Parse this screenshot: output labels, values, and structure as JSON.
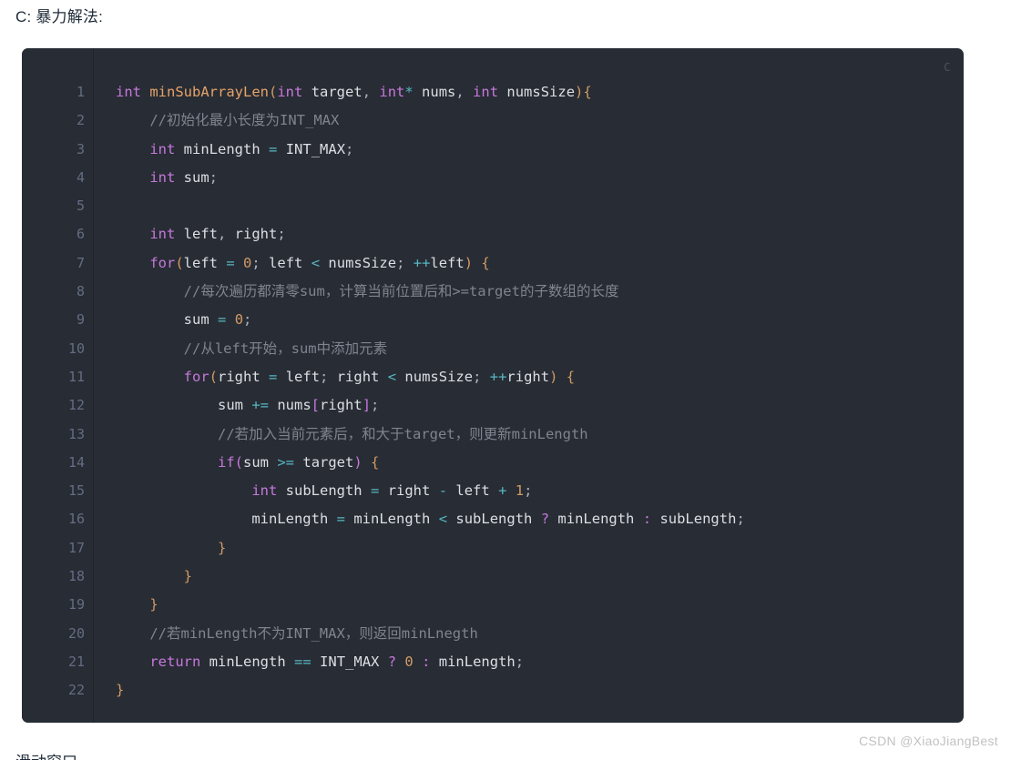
{
  "page": {
    "heading": "C: 暴力解法:",
    "footer_partial": "滑动窗口"
  },
  "code_block": {
    "language_label": "C",
    "line_numbers": [
      "1",
      "2",
      "3",
      "4",
      "5",
      "6",
      "7",
      "8",
      "9",
      "10",
      "11",
      "12",
      "13",
      "14",
      "15",
      "16",
      "17",
      "18",
      "19",
      "20",
      "21",
      "22"
    ],
    "lines": [
      {
        "n": "1",
        "text": "int minSubArrayLen(int target, int* nums, int numsSize){"
      },
      {
        "n": "2",
        "text": "    //初始化最小长度为INT_MAX"
      },
      {
        "n": "3",
        "text": "    int minLength = INT_MAX;"
      },
      {
        "n": "4",
        "text": "    int sum;"
      },
      {
        "n": "5",
        "text": ""
      },
      {
        "n": "6",
        "text": "    int left, right;"
      },
      {
        "n": "7",
        "text": "    for(left = 0; left < numsSize; ++left) {"
      },
      {
        "n": "8",
        "text": "        //每次遍历都清零sum，计算当前位置后和>=target的子数组的长度"
      },
      {
        "n": "9",
        "text": "        sum = 0;"
      },
      {
        "n": "10",
        "text": "        //从left开始，sum中添加元素"
      },
      {
        "n": "11",
        "text": "        for(right = left; right < numsSize; ++right) {"
      },
      {
        "n": "12",
        "text": "            sum += nums[right];"
      },
      {
        "n": "13",
        "text": "            //若加入当前元素后，和大于target，则更新minLength"
      },
      {
        "n": "14",
        "text": "            if(sum >= target) {"
      },
      {
        "n": "15",
        "text": "                int subLength = right - left + 1;"
      },
      {
        "n": "16",
        "text": "                minLength = minLength < subLength ? minLength : subLength;"
      },
      {
        "n": "17",
        "text": "            }"
      },
      {
        "n": "18",
        "text": "        }"
      },
      {
        "n": "19",
        "text": "    }"
      },
      {
        "n": "20",
        "text": "    //若minLength不为INT_MAX，则返回minLnegth"
      },
      {
        "n": "21",
        "text": "    return minLength == INT_MAX ? 0 : minLength;"
      },
      {
        "n": "22",
        "text": "}"
      }
    ],
    "tokens": [
      [
        {
          "c": "t-kw",
          "s": "int"
        },
        {
          "c": "t-pl",
          "s": " "
        },
        {
          "c": "t-fn",
          "s": "minSubArrayLen"
        },
        {
          "c": "t-br",
          "s": "("
        },
        {
          "c": "t-kw",
          "s": "int"
        },
        {
          "c": "t-pl",
          "s": " "
        },
        {
          "c": "t-var",
          "s": "target"
        },
        {
          "c": "t-pl",
          "s": ", "
        },
        {
          "c": "t-kw",
          "s": "int"
        },
        {
          "c": "t-op",
          "s": "*"
        },
        {
          "c": "t-pl",
          "s": " "
        },
        {
          "c": "t-var",
          "s": "nums"
        },
        {
          "c": "t-pl",
          "s": ", "
        },
        {
          "c": "t-kw",
          "s": "int"
        },
        {
          "c": "t-pl",
          "s": " "
        },
        {
          "c": "t-var",
          "s": "numsSize"
        },
        {
          "c": "t-br",
          "s": ")"
        },
        {
          "c": "t-br",
          "s": "{"
        }
      ],
      [
        {
          "c": "t-pl",
          "s": "    "
        },
        {
          "c": "t-cmt",
          "s": "//初始化最小长度为INT_MAX"
        }
      ],
      [
        {
          "c": "t-pl",
          "s": "    "
        },
        {
          "c": "t-kw",
          "s": "int"
        },
        {
          "c": "t-pl",
          "s": " "
        },
        {
          "c": "t-var",
          "s": "minLength"
        },
        {
          "c": "t-pl",
          "s": " "
        },
        {
          "c": "t-op",
          "s": "="
        },
        {
          "c": "t-pl",
          "s": " "
        },
        {
          "c": "t-con",
          "s": "INT_MAX"
        },
        {
          "c": "t-pl",
          "s": ";"
        }
      ],
      [
        {
          "c": "t-pl",
          "s": "    "
        },
        {
          "c": "t-kw",
          "s": "int"
        },
        {
          "c": "t-pl",
          "s": " "
        },
        {
          "c": "t-var",
          "s": "sum"
        },
        {
          "c": "t-pl",
          "s": ";"
        }
      ],
      [],
      [
        {
          "c": "t-pl",
          "s": "    "
        },
        {
          "c": "t-kw",
          "s": "int"
        },
        {
          "c": "t-pl",
          "s": " "
        },
        {
          "c": "t-var",
          "s": "left"
        },
        {
          "c": "t-pl",
          "s": ", "
        },
        {
          "c": "t-var",
          "s": "right"
        },
        {
          "c": "t-pl",
          "s": ";"
        }
      ],
      [
        {
          "c": "t-pl",
          "s": "    "
        },
        {
          "c": "t-kw",
          "s": "for"
        },
        {
          "c": "t-br",
          "s": "("
        },
        {
          "c": "t-var",
          "s": "left"
        },
        {
          "c": "t-pl",
          "s": " "
        },
        {
          "c": "t-op",
          "s": "="
        },
        {
          "c": "t-pl",
          "s": " "
        },
        {
          "c": "t-num",
          "s": "0"
        },
        {
          "c": "t-pl",
          "s": "; "
        },
        {
          "c": "t-var",
          "s": "left"
        },
        {
          "c": "t-pl",
          "s": " "
        },
        {
          "c": "t-op",
          "s": "<"
        },
        {
          "c": "t-pl",
          "s": " "
        },
        {
          "c": "t-var",
          "s": "numsSize"
        },
        {
          "c": "t-pl",
          "s": "; "
        },
        {
          "c": "t-op",
          "s": "++"
        },
        {
          "c": "t-var",
          "s": "left"
        },
        {
          "c": "t-br",
          "s": ")"
        },
        {
          "c": "t-pl",
          "s": " "
        },
        {
          "c": "t-br",
          "s": "{"
        }
      ],
      [
        {
          "c": "t-pl",
          "s": "        "
        },
        {
          "c": "t-cmt",
          "s": "//每次遍历都清零sum，计算当前位置后和>=target的子数组的长度"
        }
      ],
      [
        {
          "c": "t-pl",
          "s": "        "
        },
        {
          "c": "t-var",
          "s": "sum"
        },
        {
          "c": "t-pl",
          "s": " "
        },
        {
          "c": "t-op",
          "s": "="
        },
        {
          "c": "t-pl",
          "s": " "
        },
        {
          "c": "t-num",
          "s": "0"
        },
        {
          "c": "t-pl",
          "s": ";"
        }
      ],
      [
        {
          "c": "t-pl",
          "s": "        "
        },
        {
          "c": "t-cmt",
          "s": "//从left开始，sum中添加元素"
        }
      ],
      [
        {
          "c": "t-pl",
          "s": "        "
        },
        {
          "c": "t-kw",
          "s": "for"
        },
        {
          "c": "t-br",
          "s": "("
        },
        {
          "c": "t-var",
          "s": "right"
        },
        {
          "c": "t-pl",
          "s": " "
        },
        {
          "c": "t-op",
          "s": "="
        },
        {
          "c": "t-pl",
          "s": " "
        },
        {
          "c": "t-var",
          "s": "left"
        },
        {
          "c": "t-pl",
          "s": "; "
        },
        {
          "c": "t-var",
          "s": "right"
        },
        {
          "c": "t-pl",
          "s": " "
        },
        {
          "c": "t-op",
          "s": "<"
        },
        {
          "c": "t-pl",
          "s": " "
        },
        {
          "c": "t-var",
          "s": "numsSize"
        },
        {
          "c": "t-pl",
          "s": "; "
        },
        {
          "c": "t-op",
          "s": "++"
        },
        {
          "c": "t-var",
          "s": "right"
        },
        {
          "c": "t-br",
          "s": ")"
        },
        {
          "c": "t-pl",
          "s": " "
        },
        {
          "c": "t-br",
          "s": "{"
        }
      ],
      [
        {
          "c": "t-pl",
          "s": "            "
        },
        {
          "c": "t-var",
          "s": "sum"
        },
        {
          "c": "t-pl",
          "s": " "
        },
        {
          "c": "t-op",
          "s": "+="
        },
        {
          "c": "t-pl",
          "s": " "
        },
        {
          "c": "t-var",
          "s": "nums"
        },
        {
          "c": "t-pun",
          "s": "["
        },
        {
          "c": "t-var",
          "s": "right"
        },
        {
          "c": "t-pun",
          "s": "]"
        },
        {
          "c": "t-pl",
          "s": ";"
        }
      ],
      [
        {
          "c": "t-pl",
          "s": "            "
        },
        {
          "c": "t-cmt",
          "s": "//若加入当前元素后，和大于target，则更新minLength"
        }
      ],
      [
        {
          "c": "t-pl",
          "s": "            "
        },
        {
          "c": "t-kw",
          "s": "if"
        },
        {
          "c": "t-pun",
          "s": "("
        },
        {
          "c": "t-var",
          "s": "sum"
        },
        {
          "c": "t-pl",
          "s": " "
        },
        {
          "c": "t-op",
          "s": ">="
        },
        {
          "c": "t-pl",
          "s": " "
        },
        {
          "c": "t-var",
          "s": "target"
        },
        {
          "c": "t-pun",
          "s": ")"
        },
        {
          "c": "t-pl",
          "s": " "
        },
        {
          "c": "t-br",
          "s": "{"
        }
      ],
      [
        {
          "c": "t-pl",
          "s": "                "
        },
        {
          "c": "t-kw",
          "s": "int"
        },
        {
          "c": "t-pl",
          "s": " "
        },
        {
          "c": "t-var",
          "s": "subLength"
        },
        {
          "c": "t-pl",
          "s": " "
        },
        {
          "c": "t-op",
          "s": "="
        },
        {
          "c": "t-pl",
          "s": " "
        },
        {
          "c": "t-var",
          "s": "right"
        },
        {
          "c": "t-pl",
          "s": " "
        },
        {
          "c": "t-op",
          "s": "-"
        },
        {
          "c": "t-pl",
          "s": " "
        },
        {
          "c": "t-var",
          "s": "left"
        },
        {
          "c": "t-pl",
          "s": " "
        },
        {
          "c": "t-op",
          "s": "+"
        },
        {
          "c": "t-pl",
          "s": " "
        },
        {
          "c": "t-num",
          "s": "1"
        },
        {
          "c": "t-pl",
          "s": ";"
        }
      ],
      [
        {
          "c": "t-pl",
          "s": "                "
        },
        {
          "c": "t-var",
          "s": "minLength"
        },
        {
          "c": "t-pl",
          "s": " "
        },
        {
          "c": "t-op",
          "s": "="
        },
        {
          "c": "t-pl",
          "s": " "
        },
        {
          "c": "t-var",
          "s": "minLength"
        },
        {
          "c": "t-pl",
          "s": " "
        },
        {
          "c": "t-op",
          "s": "<"
        },
        {
          "c": "t-pl",
          "s": " "
        },
        {
          "c": "t-var",
          "s": "subLength"
        },
        {
          "c": "t-pl",
          "s": " "
        },
        {
          "c": "t-pun",
          "s": "?"
        },
        {
          "c": "t-pl",
          "s": " "
        },
        {
          "c": "t-var",
          "s": "minLength"
        },
        {
          "c": "t-pl",
          "s": " "
        },
        {
          "c": "t-pun",
          "s": ":"
        },
        {
          "c": "t-pl",
          "s": " "
        },
        {
          "c": "t-var",
          "s": "subLength"
        },
        {
          "c": "t-pl",
          "s": ";"
        }
      ],
      [
        {
          "c": "t-pl",
          "s": "            "
        },
        {
          "c": "t-br",
          "s": "}"
        }
      ],
      [
        {
          "c": "t-pl",
          "s": "        "
        },
        {
          "c": "t-br",
          "s": "}"
        }
      ],
      [
        {
          "c": "t-pl",
          "s": "    "
        },
        {
          "c": "t-br",
          "s": "}"
        }
      ],
      [
        {
          "c": "t-pl",
          "s": "    "
        },
        {
          "c": "t-cmt",
          "s": "//若minLength不为INT_MAX，则返回minLnegth"
        }
      ],
      [
        {
          "c": "t-pl",
          "s": "    "
        },
        {
          "c": "t-kw",
          "s": "return"
        },
        {
          "c": "t-pl",
          "s": " "
        },
        {
          "c": "t-var",
          "s": "minLength"
        },
        {
          "c": "t-pl",
          "s": " "
        },
        {
          "c": "t-op",
          "s": "=="
        },
        {
          "c": "t-pl",
          "s": " "
        },
        {
          "c": "t-con",
          "s": "INT_MAX"
        },
        {
          "c": "t-pl",
          "s": " "
        },
        {
          "c": "t-pun",
          "s": "?"
        },
        {
          "c": "t-pl",
          "s": " "
        },
        {
          "c": "t-num",
          "s": "0"
        },
        {
          "c": "t-pl",
          "s": " "
        },
        {
          "c": "t-pun",
          "s": ":"
        },
        {
          "c": "t-pl",
          "s": " "
        },
        {
          "c": "t-var",
          "s": "minLength"
        },
        {
          "c": "t-pl",
          "s": ";"
        }
      ],
      [
        {
          "c": "t-br",
          "s": "}"
        }
      ]
    ]
  },
  "watermark": {
    "text": "CSDN @XiaoJiangBest"
  },
  "colors": {
    "page_background": "#ffffff",
    "code_background": "#282c34",
    "gutter_border": "#20242c",
    "line_number": "#636d83",
    "keyword": "#c678dd",
    "function": "#e5a36a",
    "number": "#d19a66",
    "operator": "#56b6c2",
    "comment": "#7f848e",
    "identifier": "#dcdfe4",
    "heading_text": "#1f2b38",
    "watermark_text": "#c2c2c2"
  }
}
